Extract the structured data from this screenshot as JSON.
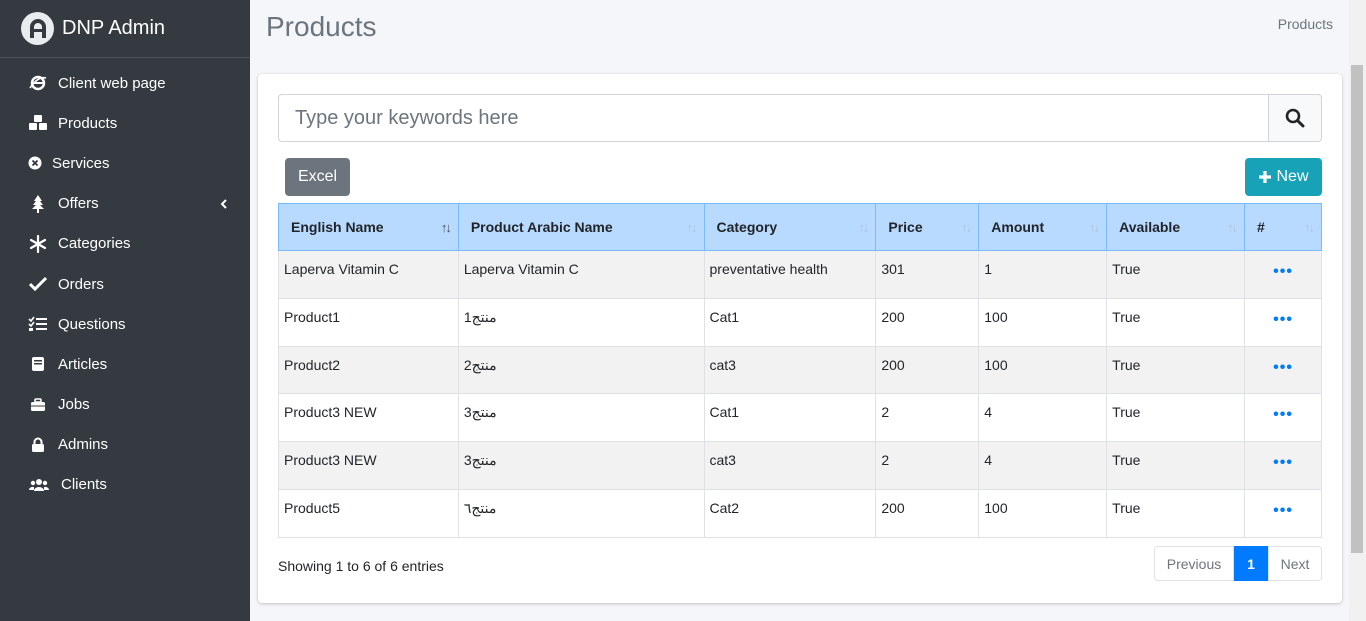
{
  "brand": {
    "name": "DNP Admin"
  },
  "sidebar": {
    "items": [
      {
        "label": "Client web page",
        "icon": "ie-icon"
      },
      {
        "label": "Products",
        "icon": "cubes-icon"
      },
      {
        "label": "Services",
        "icon": "times-circle-icon"
      },
      {
        "label": "Offers",
        "icon": "tree-icon"
      },
      {
        "label": "Categories",
        "icon": "snowflake-icon"
      },
      {
        "label": "Orders",
        "icon": "check-icon"
      },
      {
        "label": "Questions",
        "icon": "tasks-icon"
      },
      {
        "label": "Articles",
        "icon": "book-icon"
      },
      {
        "label": "Jobs",
        "icon": "briefcase-icon"
      },
      {
        "label": "Admins",
        "icon": "lock-icon"
      },
      {
        "label": "Clients",
        "icon": "users-icon"
      }
    ]
  },
  "header": {
    "title": "Products",
    "breadcrumb": "Products"
  },
  "search": {
    "placeholder": "Type your keywords here",
    "value": ""
  },
  "toolbar": {
    "excel_label": "Excel",
    "new_label": "New"
  },
  "table": {
    "columns": [
      "English Name",
      "Product Arabic Name",
      "Category",
      "Price",
      "Amount",
      "Available",
      "#"
    ],
    "rows": [
      [
        "Laperva Vitamin C",
        "Laperva Vitamin C",
        "preventative health",
        "301",
        "1",
        "True"
      ],
      [
        "Product1",
        "منتج1",
        "Cat1",
        "200",
        "100",
        "True"
      ],
      [
        "Product2",
        "منتج2",
        "cat3",
        "200",
        "100",
        "True"
      ],
      [
        "Product3 NEW",
        "منتج3",
        "Cat1",
        "2",
        "4",
        "True"
      ],
      [
        "Product3 NEW",
        "منتج3",
        "cat3",
        "2",
        "4",
        "True"
      ],
      [
        "Product5",
        "منتج٦",
        "Cat2",
        "200",
        "100",
        "True"
      ]
    ],
    "action_label": "•••"
  },
  "footer": {
    "info": "Showing 1 to 6 of 6 entries",
    "previous": "Previous",
    "current_page": "1",
    "next": "Next"
  },
  "colors": {
    "sidebar": "#343a40",
    "header_bg": "#b8daff",
    "accent": "#007bff",
    "new_button": "#17a2b8",
    "excel_button": "#6c757d"
  }
}
